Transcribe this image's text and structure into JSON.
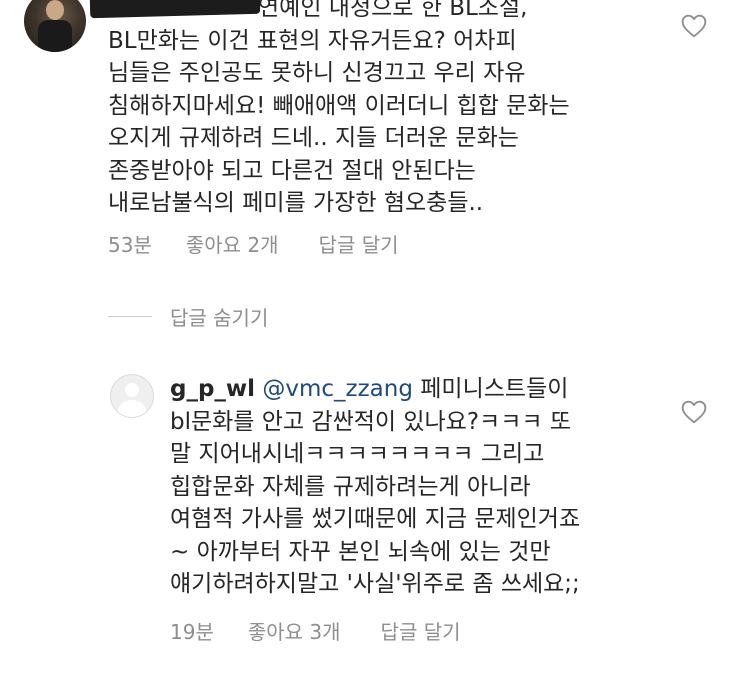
{
  "comment1": {
    "text": "BL만화는 이건 표현의 자유거든요? 어차피\n님들은 주인공도 못하니 신경끄고 우리 자유\n침해하지마세요! 빼애애액 이러더니 힙합 문화는\n오지게 규제하려 드네.. 지들 더러운 문화는\n존중받아야 되고 다른건 절대 안된다는\n내로남불식의 페미를 가장한 혐오충들..",
    "partial_first_line": "연예인 내청으로 한 BL소설,",
    "time": "53분",
    "likes": "좋아요 2개",
    "reply": "답글 달기"
  },
  "hide_replies": "답글 숨기기",
  "comment2": {
    "username": "g_p_wl",
    "mention": "@vmc_zzang",
    "text_first": "페미니스트들이",
    "text": "bl문화를 안고 감싼적이 있나요?ㅋㅋㅋ 또\n말 지어내시네ㅋㅋㅋㅋㅋㅋㅋㅋ 그리고\n힙합문화 자체를 규제하려는게 아니라\n여혐적 가사를 썼기때문에 지금 문제인거죠\n~ 아까부터 자꾸 본인 뇌속에 있는 것만\n얘기하려하지말고 '사실'위주로 좀 쓰세요;;",
    "time": "19분",
    "likes": "좋아요 3개",
    "reply": "답글 달기"
  },
  "colors": {
    "text": "#262626",
    "meta": "#8e8e8e",
    "mention": "#1f4a7a"
  },
  "icons": {
    "like": "heart-outline-icon",
    "avatar_default": "default-avatar-icon"
  }
}
